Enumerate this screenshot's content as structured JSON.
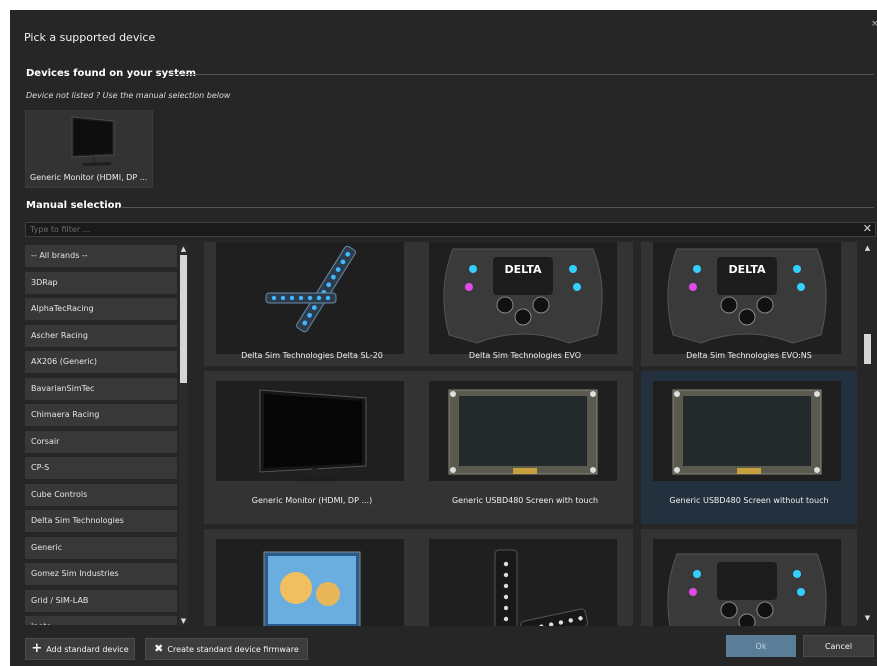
{
  "dialog": {
    "title": "Pick a supported device",
    "close_glyph": "×"
  },
  "found": {
    "section_label": "Devices found on your system",
    "hint": "Device not listed ? Use the manual selection below",
    "device": {
      "label": "Generic Monitor (HDMI, DP ...",
      "icon": "monitor-icon"
    }
  },
  "manual": {
    "section_label": "Manual selection",
    "filter_placeholder": "Type to filter ...",
    "filter_clear_glyph": "✕"
  },
  "brands": [
    "-- All brands --",
    "3DRap",
    "AlphaTecRacing",
    "Ascher Racing",
    "AX206 (Generic)",
    "BavarianSimTec",
    "Chimaera Racing",
    "Corsair",
    "CP-S",
    "Cube Controls",
    "Delta Sim Technologies",
    "Generic",
    "Gomez Sim Industries",
    "Grid / SIM-LAB",
    "Ipoto"
  ],
  "devices": [
    {
      "label": "Delta Sim Technologies Delta SL-20",
      "icon": "led-bar-icon",
      "selected": false
    },
    {
      "label": "Delta Sim Technologies EVO",
      "icon": "steering-wheel-icon",
      "badge": "DELTA",
      "selected": false
    },
    {
      "label": "Delta Sim Technologies EVO:NS",
      "icon": "steering-wheel-icon",
      "badge": "DELTA",
      "selected": false
    },
    {
      "label": "Generic Monitor (HDMI, DP ...)",
      "icon": "monitor-icon",
      "selected": false
    },
    {
      "label": "Generic USBD480 Screen with touch",
      "icon": "lcd-screen-icon",
      "selected": false
    },
    {
      "label": "Generic USBD480 Screen without touch",
      "icon": "lcd-screen-icon",
      "selected": true
    },
    {
      "label": "",
      "icon": "display-panel-icon",
      "selected": false
    },
    {
      "label": "",
      "icon": "button-box-icon",
      "selected": false
    },
    {
      "label": "",
      "icon": "steering-wheel-icon",
      "selected": false
    }
  ],
  "footer": {
    "add_label": "Add standard device",
    "create_label": "Create standard device firmware",
    "ok_label": "Ok",
    "cancel_label": "Cancel"
  },
  "colors": {
    "background": "#262626",
    "card": "#333333",
    "selected_card": "#22313d",
    "ok_button": "#5a7e98"
  }
}
